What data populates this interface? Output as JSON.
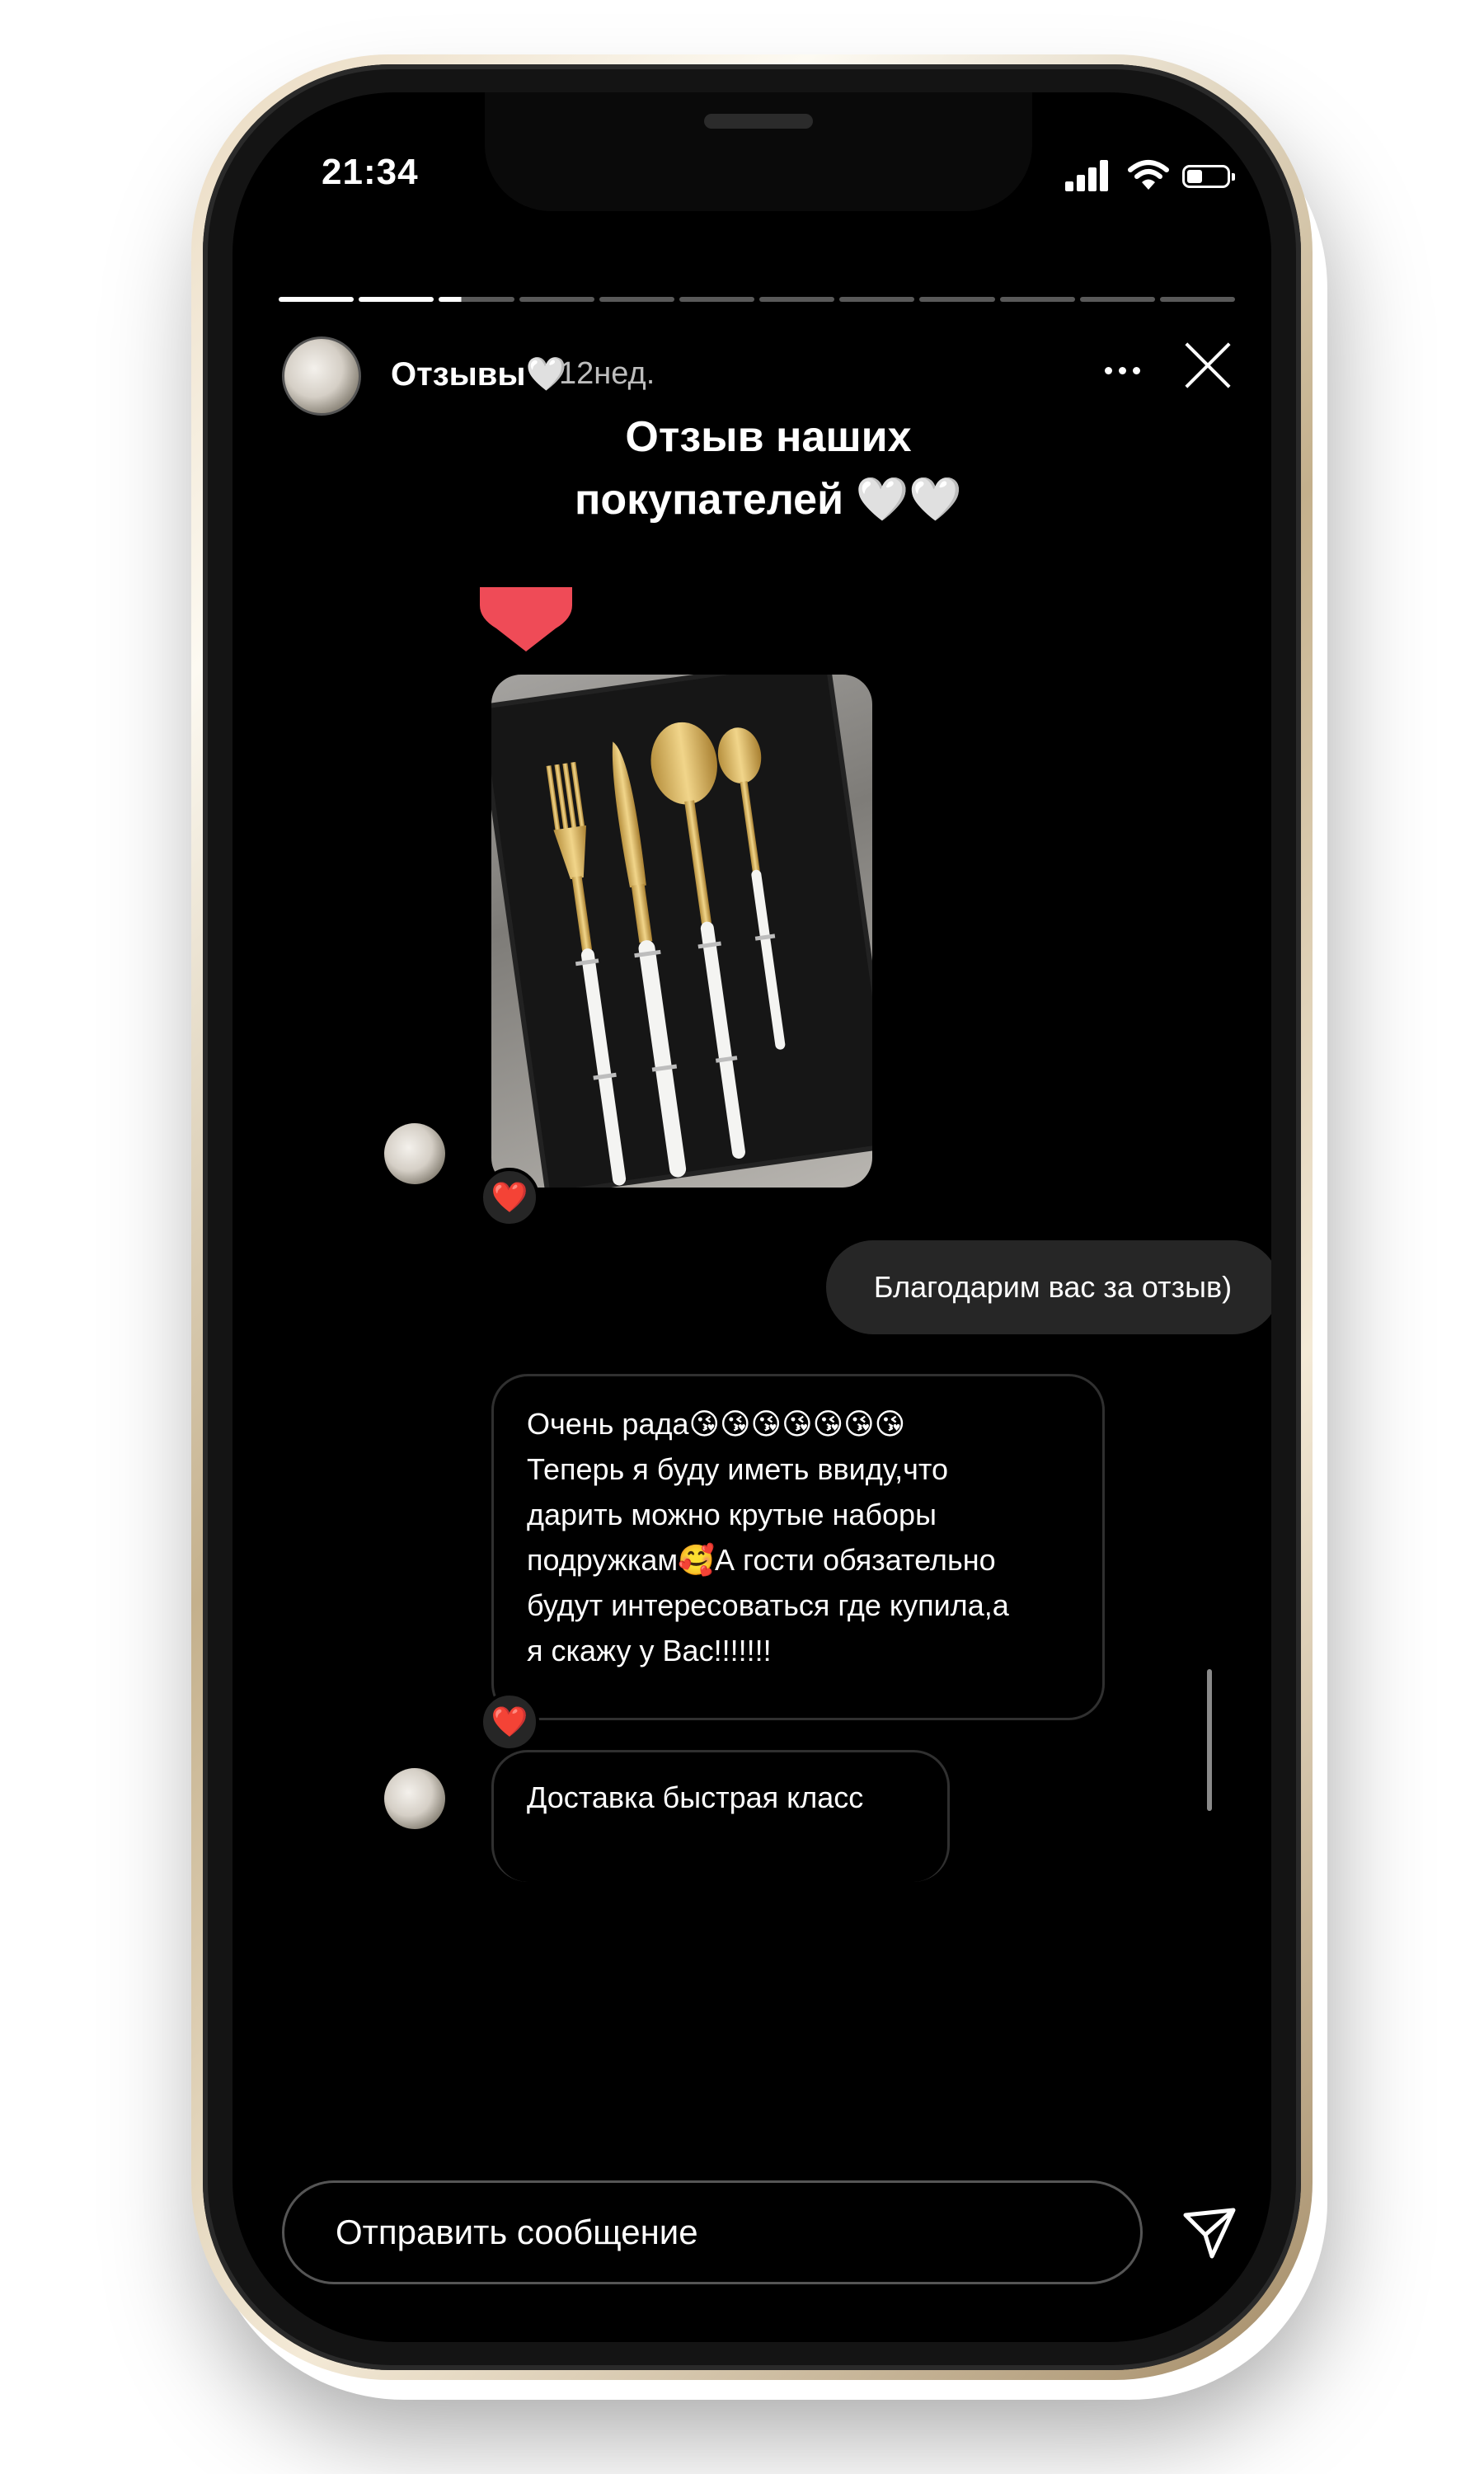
{
  "status_bar": {
    "time": "21:34"
  },
  "story": {
    "account_name": "Отзывы",
    "name_heart": "🤍",
    "posted_ago": "12нед.",
    "progress": {
      "segments_total": 12,
      "segments_viewed": 2,
      "current_fraction": 0.3
    },
    "caption_line1": "Отзыв наших",
    "caption_line2": "покупателей 🤍🤍"
  },
  "chat": {
    "photo_reaction": "❤️",
    "outgoing_message": "Благодарим вас за отзыв)",
    "incoming_message": {
      "lines": [
        "Очень рада😘😘😘😘😘😘😘",
        "Теперь я буду иметь ввиду,что",
        "дарить можно крутые наборы",
        "подружкам🥰А гости обязательно",
        "будут интересоваться где купила,а",
        "я скажу у Вас!!!!!!!"
      ],
      "reaction": "❤️"
    },
    "incoming_message_2": "Доставка быстрая класс"
  },
  "reply_bar": {
    "placeholder": "Отправить сообщение"
  },
  "colors": {
    "background": "#000000",
    "bubble": "#262626",
    "reaction_heart": "#e0245e",
    "sticker_heart": "#ef4b57"
  }
}
